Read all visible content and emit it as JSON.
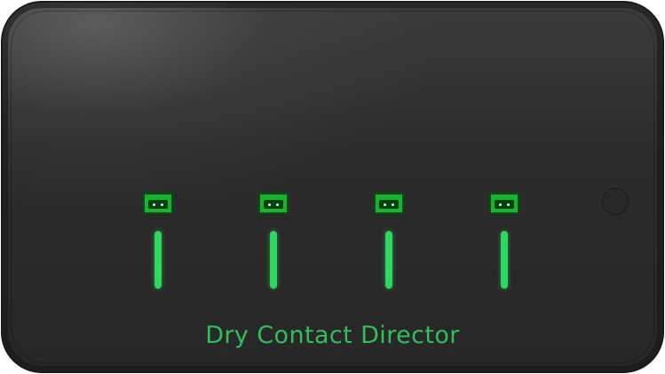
{
  "device": {
    "label": "Dry Contact Director",
    "body_color": "#2b2b2b",
    "accent_color": "#2fd65f",
    "channels": [
      {
        "icon": "terminal-block-connector-icon",
        "indicator": "led-indicator"
      },
      {
        "icon": "terminal-block-connector-icon",
        "indicator": "led-indicator"
      },
      {
        "icon": "terminal-block-connector-icon",
        "indicator": "led-indicator"
      },
      {
        "icon": "terminal-block-connector-icon",
        "indicator": "led-indicator"
      }
    ],
    "button": {
      "icon": "power-button-icon"
    }
  }
}
